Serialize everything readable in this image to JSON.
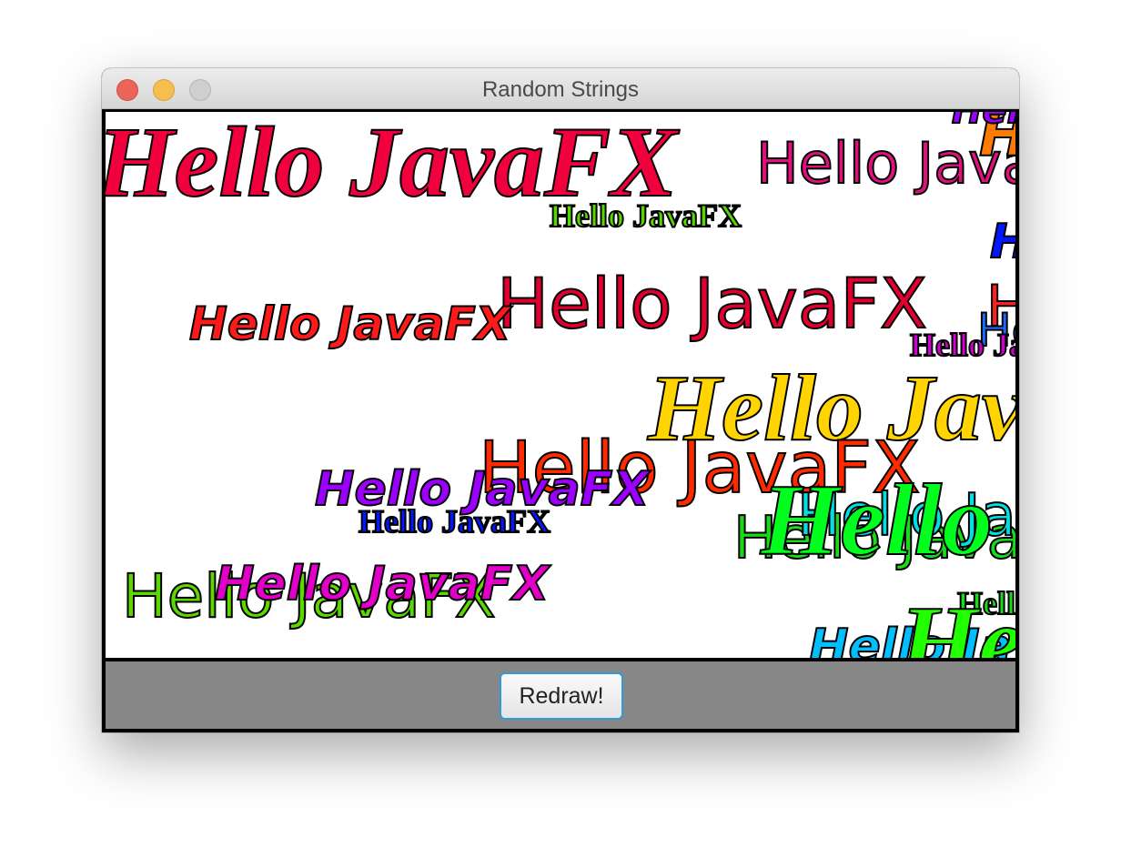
{
  "window": {
    "title": "Random Strings"
  },
  "canvas": {
    "strings": [
      {
        "text": "Hello JavaFX",
        "color": "#f0003c",
        "font": "serif",
        "italic": true,
        "bold": true
      },
      {
        "text": "Hello JavaFX",
        "color": "#e0107e",
        "font": "sans",
        "italic": false,
        "bold": false
      },
      {
        "text": "Hello JavaFX",
        "color": "#ff7a00",
        "font": "sans",
        "italic": true,
        "bold": true
      },
      {
        "text": "Hello JavaFX",
        "color": "#9b00ff",
        "font": "sans",
        "italic": true,
        "bold": true
      },
      {
        "text": "Hello JavaFX",
        "color": "#55d800",
        "font": "serif",
        "italic": false,
        "bold": true
      },
      {
        "text": "Hello JavaFX",
        "color": "#0018ff",
        "font": "sans",
        "italic": true,
        "bold": true
      },
      {
        "text": "Hello JavaFX",
        "color": "#e00030",
        "font": "sans",
        "italic": false,
        "bold": false
      },
      {
        "text": "Hello JavaFX",
        "color": "#ff1a1a",
        "font": "sans",
        "italic": true,
        "bold": true
      },
      {
        "text": "Hello JavaFX",
        "color": "#ff2020",
        "font": "sans",
        "italic": false,
        "bold": false
      },
      {
        "text": "Hello JavaFX",
        "color": "#1e6cff",
        "font": "sans",
        "italic": false,
        "bold": false
      },
      {
        "text": "Hello JavaFX",
        "color": "#d000d0",
        "font": "serif",
        "italic": false,
        "bold": true
      },
      {
        "text": "Hello JavaFX",
        "color": "#ffd400",
        "font": "serif",
        "italic": true,
        "bold": true
      },
      {
        "text": "Hello JavaFX",
        "color": "#ff2a00",
        "font": "sans",
        "italic": false,
        "bold": false
      },
      {
        "text": "Hello JavaFX",
        "color": "#9b00ff",
        "font": "sans",
        "italic": true,
        "bold": true
      },
      {
        "text": "Hello JavaFX",
        "color": "#0018ff",
        "font": "serif",
        "italic": false,
        "bold": true
      },
      {
        "text": "Hello JavaFX",
        "color": "#1ad81a",
        "font": "sans",
        "italic": false,
        "bold": false
      },
      {
        "text": "Hello JavaFX",
        "color": "#00e0e0",
        "font": "sans",
        "italic": false,
        "bold": false
      },
      {
        "text": "Hello JavaFX",
        "color": "#00ff1e",
        "font": "serif",
        "italic": true,
        "bold": true
      },
      {
        "text": "Hello JavaFX",
        "color": "#5cd800",
        "font": "sans",
        "italic": false,
        "bold": false
      },
      {
        "text": "Hello JavaFX",
        "color": "#e000c8",
        "font": "sans",
        "italic": true,
        "bold": true
      },
      {
        "text": "Hello JavaFX",
        "color": "#1ad81a",
        "font": "serif",
        "italic": false,
        "bold": true
      },
      {
        "text": "Hello JavaFX",
        "color": "#00bfff",
        "font": "sans",
        "italic": true,
        "bold": true
      },
      {
        "text": "Hello JavaFX",
        "color": "#22ff00",
        "font": "serif",
        "italic": true,
        "bold": true
      }
    ]
  },
  "footer": {
    "redraw_label": "Redraw!"
  }
}
